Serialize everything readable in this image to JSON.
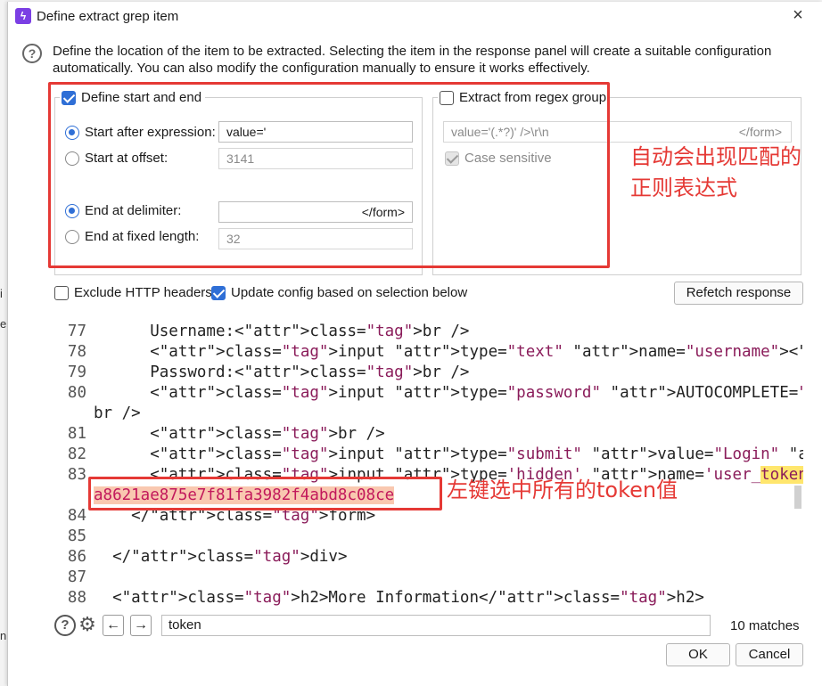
{
  "dialog": {
    "title": "Define extract grep item",
    "close_glyph": "×",
    "description": "Define the location of the item to be extracted. Selecting the item in the response panel will create a suitable configuration automatically. You can also modify the configuration manually to ensure it works effectively."
  },
  "start_end": {
    "legend": "Define start and end",
    "checked": true,
    "start_after_label": "Start after expression:",
    "start_after_value": "value='",
    "start_offset_label": "Start at offset:",
    "start_offset_value": "3141",
    "end_delim_label": "End at delimiter:",
    "end_delim_value": "</form>",
    "end_fixed_label": "End at fixed length:",
    "end_fixed_value": "32"
  },
  "regex": {
    "legend": "Extract from regex group",
    "checked": false,
    "expression": "value='(.*?)' />\\r\\n",
    "expression_end": "</form>",
    "case_label": "Case sensitive"
  },
  "options": {
    "exclude_label": "Exclude HTTP headers",
    "update_label": "Update config based on selection below",
    "refetch_label": "Refetch response"
  },
  "annotations": {
    "regex_note_line1": "自动会出现匹配的",
    "regex_note_line2": "正则表达式",
    "token_note": "左键选中所有的token值"
  },
  "code_lines": [
    {
      "n": "77",
      "t": "      Username:<br />"
    },
    {
      "n": "78",
      "t": "      <input type=\"text\" name=\"username\"><br />"
    },
    {
      "n": "79",
      "t": "      Password:<br />"
    },
    {
      "n": "80",
      "t": "      <input type=\"password\" AUTOCOMPLETE=\"off\" name=\"password\"><"
    },
    {
      "n": "",
      "t": "br />"
    },
    {
      "n": "81",
      "t": "      <br />"
    },
    {
      "n": "82",
      "t": "      <input type=\"submit\" value=\"Login\" name=\"Login\">"
    },
    {
      "n": "83",
      "t": "      <input type='hidden' name='user_token' value='"
    },
    {
      "n": "",
      "t": "a8621ae875e7f81fa3982f4abd8c08ce"
    },
    {
      "n": "84",
      "t": "    </form>"
    },
    {
      "n": "85",
      "t": ""
    },
    {
      "n": "86",
      "t": "  </div>"
    },
    {
      "n": "87",
      "t": ""
    },
    {
      "n": "88",
      "t": "  <h2>More Information</h2>"
    }
  ],
  "search": {
    "value": "token",
    "matches": "10 matches"
  },
  "buttons": {
    "ok": "OK",
    "cancel": "Cancel"
  },
  "colors": {
    "accent": "#2f6fd6",
    "annotation_red": "#e53935",
    "token_selection": "#f9c8b0",
    "search_highlight": "#ffe66d"
  }
}
